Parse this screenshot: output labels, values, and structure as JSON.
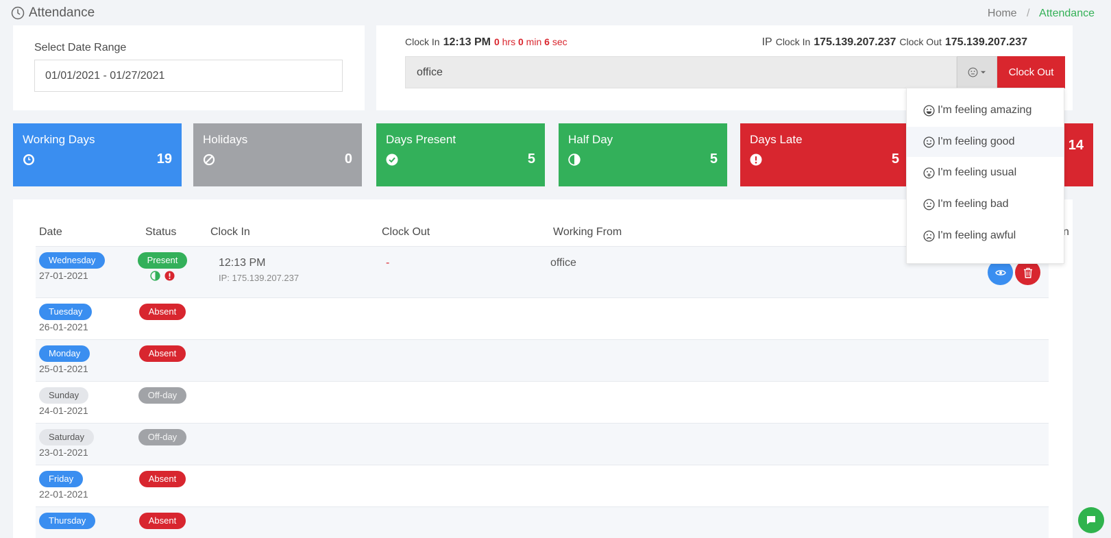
{
  "page": {
    "title": "Attendance"
  },
  "breadcrumb": {
    "home": "Home",
    "separator": "/",
    "current": "Attendance"
  },
  "date_range": {
    "label": "Select Date Range",
    "value": "01/01/2021 - 01/27/2021"
  },
  "clock": {
    "clock_in_label": "Clock In",
    "clock_in_time": "12:13 PM",
    "hrs_value": "0",
    "hrs_label": "hrs",
    "min_value": "0",
    "min_label": "min",
    "sec_value": "6",
    "sec_label": "sec",
    "ip_label": "IP",
    "ip_clock_in_label": "Clock In",
    "ip_clock_in": "175.139.207.237",
    "ip_clock_out_label": "Clock Out",
    "ip_clock_out": "175.139.207.237",
    "working_from": "office",
    "mood_icon": "neutral-face-icon",
    "clock_out_button": "Clock Out"
  },
  "stats": [
    {
      "title": "Working Days",
      "value": "19",
      "icon": "clock-icon",
      "color": "#3a8ef0"
    },
    {
      "title": "Holidays",
      "value": "0",
      "icon": "ban-icon",
      "color": "#a1a3a7"
    },
    {
      "title": "Days Present",
      "value": "5",
      "icon": "check-circle-icon",
      "color": "#33b05a"
    },
    {
      "title": "Half Day",
      "value": "5",
      "icon": "half-circle-icon",
      "color": "#33b05a"
    },
    {
      "title": "Days Late",
      "value": "5",
      "icon": "exclamation-circle-icon",
      "color": "#d8262f"
    },
    {
      "title": "",
      "value": "14",
      "icon": "",
      "color": "#d8262f"
    }
  ],
  "table": {
    "headers": {
      "date": "Date",
      "status": "Status",
      "clock_in": "Clock In",
      "clock_out": "Clock Out",
      "working_from": "Working From",
      "action_tail": "n"
    },
    "rows": [
      {
        "day": "Wednesday",
        "date": "27-01-2021",
        "status": "Present",
        "clock_in": "12:13 PM",
        "ip": "IP: 175.139.207.237",
        "clock_out": "-",
        "working_from": "office"
      },
      {
        "day": "Tuesday",
        "date": "26-01-2021",
        "status": "Absent"
      },
      {
        "day": "Monday",
        "date": "25-01-2021",
        "status": "Absent"
      },
      {
        "day": "Sunday",
        "date": "24-01-2021",
        "status": "Off-day"
      },
      {
        "day": "Saturday",
        "date": "23-01-2021",
        "status": "Off-day"
      },
      {
        "day": "Friday",
        "date": "22-01-2021",
        "status": "Absent"
      },
      {
        "day": "Thursday",
        "date": "",
        "status": "Absent"
      }
    ]
  },
  "mood_menu": [
    {
      "label": "I'm feeling amazing",
      "icon": "grin-icon"
    },
    {
      "label": "I'm feeling good",
      "icon": "smile-icon"
    },
    {
      "label": "I'm feeling usual",
      "icon": "meh-icon"
    },
    {
      "label": "I'm feeling bad",
      "icon": "frown-icon"
    },
    {
      "label": "I'm feeling awful",
      "icon": "sad-icon"
    }
  ]
}
